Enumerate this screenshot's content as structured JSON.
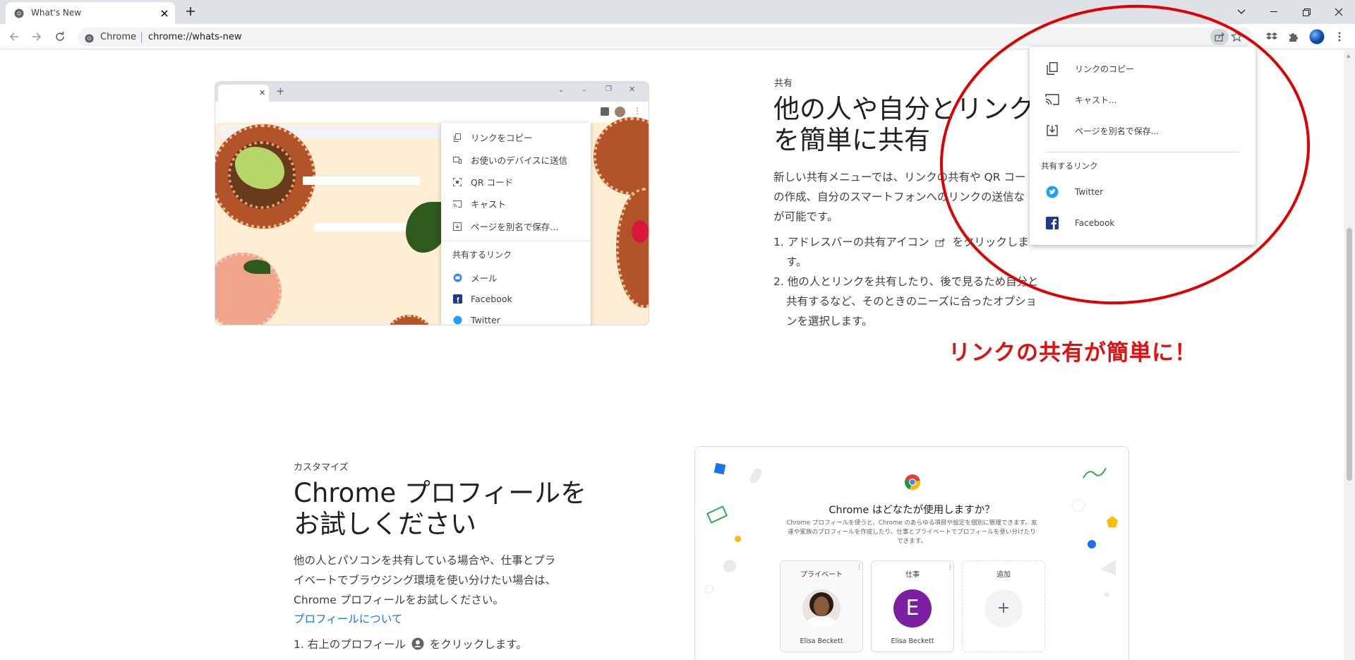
{
  "browser": {
    "tab_title": "What's New",
    "omnibox_chip": "Chrome",
    "url": "chrome://whats-new"
  },
  "share_section": {
    "eyebrow": "共有",
    "title_line1": "他の人や自分とリンク",
    "title_line2": "を簡単に共有",
    "description_line1": "新しい共有メニューでは、リンクの共有や QR コー",
    "description_line2": "の作成、自分のスマートフォンへのリンクの送信な",
    "description_line3": "が可能です。",
    "step1_line1_a": "1. アドレスバーの共有アイコン",
    "step1_line1_b": "をクリックしま",
    "step1_line2": "す。",
    "step2_line1": "2. 他の人とリンクを共有したり、後で見るため自分と",
    "step2_line2": "共有するなど、そのときのニーズに合ったオプショ",
    "step2_line3": "ンを選択します。"
  },
  "illustration_menu": {
    "items": [
      "リンクをコピー",
      "お使いのデバイスに送信",
      "QR コード",
      "キャスト",
      "ページを別名で保存..."
    ],
    "section_title": "共有するリンク",
    "share_items": [
      "メール",
      "Facebook",
      "Twitter"
    ]
  },
  "share_menu": {
    "items": [
      "リンクのコピー",
      "キャスト...",
      "ページを別名で保存..."
    ],
    "section_title": "共有するリンク",
    "share_items": [
      "Twitter",
      "Facebook"
    ]
  },
  "annotation": {
    "text": "リンクの共有が簡単に！",
    "color": "#e00000"
  },
  "profile_section": {
    "eyebrow": "カスタマイズ",
    "title_line1": "Chrome プロフィールを",
    "title_line2": "お試しください",
    "description_line1": "他の人とパソコンを共有している場合や、仕事とプラ",
    "description_line2": "イベートでブラウジング環境を使い分けたい場合は、",
    "description_line3": "Chrome プロフィールをお試しください。",
    "link": "プロフィールについて",
    "step1_a": "1. 右上のプロフィール",
    "step1_b": "をクリックします。"
  },
  "profile_picker": {
    "title": "Chrome はどなたが使用しますか？",
    "desc_line1": "Chrome プロフィールを使うと、Chrome のあらゆる項目や設定を個別に管理できます。友",
    "desc_line2": "達や家族のプロフィールを作成したり、仕事とプライベートでプロフィールを使い分けたり",
    "desc_line3": "できます。",
    "cards": [
      {
        "label": "プライベート",
        "name": "Elisa Beckett"
      },
      {
        "label": "仕事",
        "name": "Elisa Beckett",
        "initial": "E"
      },
      {
        "label": "追加"
      }
    ]
  },
  "colors": {
    "accent": "#1a73e8",
    "tabstrip": "#dee1e6",
    "avatar_purple": "#7b1fa2",
    "twitter": "#1da1f2",
    "facebook": "#1877f2"
  }
}
